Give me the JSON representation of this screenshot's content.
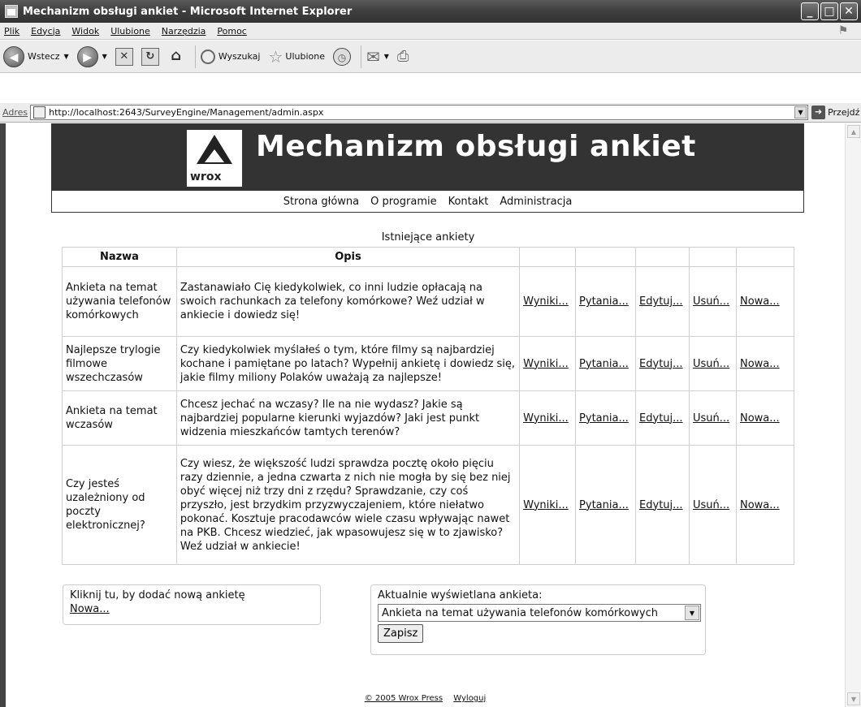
{
  "window": {
    "title": "Mechanizm obsługi ankiet - Microsoft Internet Explorer",
    "buttons": [
      "_",
      "□",
      "✕"
    ]
  },
  "menu": [
    "Plik",
    "Edycja",
    "Widok",
    "Ulubione",
    "Narzędzia",
    "Pomoc"
  ],
  "toolbar": {
    "back": "Wstecz",
    "search": "Wyszukaj",
    "favorites": "Ulubione"
  },
  "address": {
    "label": "Adres",
    "url": "http://localhost:2643/SurveyEngine/Management/admin.aspx",
    "go": "Przejdź"
  },
  "site": {
    "logo_text": "wrox",
    "title": "Mechanizm obsługi ankiet",
    "nav": [
      "Strona główna",
      "O programie",
      "Kontakt",
      "Administracja"
    ]
  },
  "surveys": {
    "caption": "Istniejące ankiety",
    "headers": {
      "name": "Nazwa",
      "description": "Opis"
    },
    "actions": [
      "Wyniki...",
      "Pytania...",
      "Edytuj...",
      "Usuń...",
      "Nowa..."
    ],
    "rows": [
      {
        "name": "Ankieta na temat używania telefonów komórkowych",
        "description": "Zastanawiało Cię kiedykolwiek, co inni ludzie opłacają na swoich rachunkach za telefony komórkowe? Weź udział w ankiecie i dowiedz się!"
      },
      {
        "name": "Najlepsze trylogie filmowe wszechczasów",
        "description": "Czy kiedykolwiek myślałeś o tym, które filmy są najbardziej kochane i pamiętane po latach? Wypełnij ankietę i dowiedz się, jakie filmy miliony Polaków uważają za najlepsze!"
      },
      {
        "name": "Ankieta na temat wczasów",
        "description": "Chcesz jechać na wczasy? Ile na nie wydasz? Jakie są najbardziej popularne kierunki wyjazdów? Jaki jest punkt widzenia mieszkańców tamtych terenów?"
      },
      {
        "name": "Czy jesteś uzależniony od poczty elektronicznej?",
        "description": "Czy wiesz, że większość ludzi sprawdza pocztę około pięciu razy dziennie, a jedna czwarta z nich nie mogła by się bez niej obyć więcej niż trzy dni z rzędu? Sprawdzanie, czy coś przyszło, jest brzydkim przyzwyczajeniem, które niełatwo pokonać. Kosztuje pracodawców wiele czasu wpływając nawet na PKB. Chcesz wiedzieć, jak wpasowujesz się w to zjawisko? Weź udział w ankiecie!"
      }
    ]
  },
  "new_survey": {
    "text": "Kliknij tu, by dodać nową ankietę",
    "link": "Nowa..."
  },
  "current_survey": {
    "label": "Aktualnie wyświetlana ankieta:",
    "selected": "Ankieta na temat używania telefonów komórkowych",
    "save": "Zapisz"
  },
  "footer": {
    "copyright": "© 2005 Wrox Press",
    "logout": "Wyloguj"
  }
}
